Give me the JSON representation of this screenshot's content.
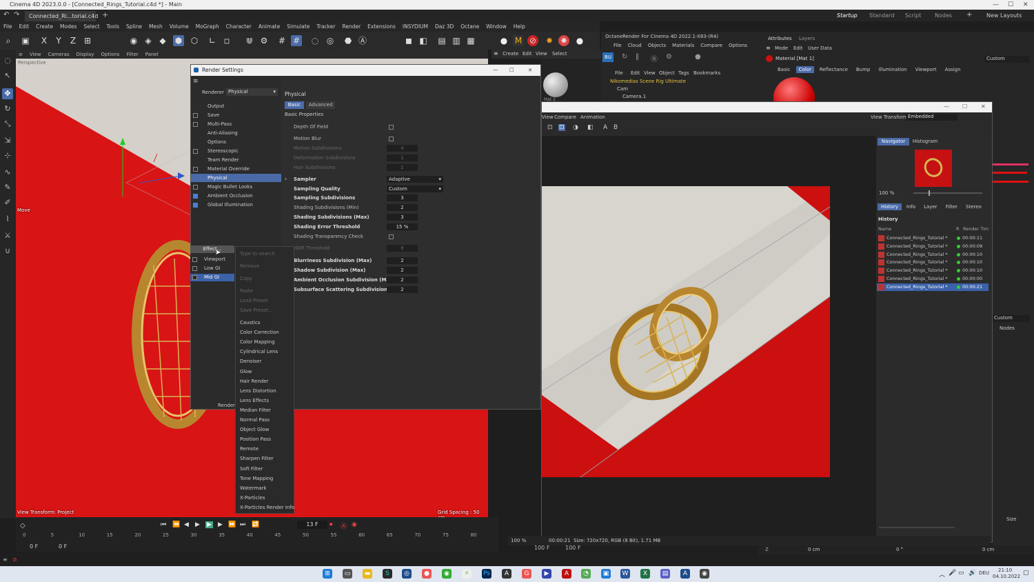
{
  "app": {
    "title": "Cinema 4D 2023.0.0 - [Connected_Rings_Tutorial.c4d *] - Main",
    "doc_tab": "Connected_Ri...torial.c4d *",
    "layouts": [
      "Startup",
      "Standard",
      "Script",
      "Nodes"
    ],
    "new_layouts": "New Layouts"
  },
  "menu": [
    "File",
    "Edit",
    "Create",
    "Modes",
    "Select",
    "Tools",
    "Spline",
    "Mesh",
    "Volume",
    "MoGraph",
    "Character",
    "Animate",
    "Simulate",
    "Tracker",
    "Render",
    "Extensions",
    "INSYDIUM",
    "Daz 3D",
    "Octane",
    "Window",
    "Help"
  ],
  "viewport": {
    "menu": [
      "View",
      "Cameras",
      "Display",
      "Options",
      "Filter",
      "Panel"
    ],
    "perspective": "Perspective",
    "move_label": "Move",
    "view_transform": "View Transform: Project",
    "grid_spacing": "Grid Spacing : 50 cm"
  },
  "timeline": {
    "frame_current": "13 F",
    "ticks": [
      "0",
      "5",
      "10",
      "15",
      "20",
      "25",
      "30",
      "35",
      "40",
      "45",
      "50",
      "55",
      "60",
      "65",
      "70",
      "75",
      "80"
    ],
    "start_a": "0 F",
    "start_b": "0 F",
    "end_a": "100 F",
    "end_b": "100 F"
  },
  "render_settings": {
    "title": "Render Settings",
    "renderer_label": "Renderer",
    "renderer_value": "Physical",
    "items": [
      {
        "label": "Output",
        "check": "none"
      },
      {
        "label": "Save",
        "check": "off"
      },
      {
        "label": "Multi-Pass",
        "check": "off"
      },
      {
        "label": "Anti-Aliasing",
        "check": "none"
      },
      {
        "label": "Options",
        "check": "none"
      },
      {
        "label": "Stereoscopic",
        "check": "off"
      },
      {
        "label": "Team Render",
        "check": "none"
      },
      {
        "label": "Material Override",
        "check": "off"
      },
      {
        "label": "Physical",
        "check": "none"
      },
      {
        "label": "Magic Bullet Looks",
        "check": "off"
      },
      {
        "label": "Ambient Occlusion",
        "check": "on"
      },
      {
        "label": "Global Illumination",
        "check": "on"
      }
    ],
    "effect_button": "Effect...",
    "effect_list": [
      "Viewport",
      "Low GI",
      "Mid GI"
    ],
    "render_button": "Render",
    "section_title": "Physical",
    "tabs": [
      "Basic",
      "Advanced"
    ],
    "group": "Basic Properties",
    "props": [
      {
        "label": "Depth Of Field",
        "type": "cb",
        "style": "normal"
      },
      {
        "label": "Motion Blur",
        "type": "cb",
        "style": "normal"
      },
      {
        "label": "Motion Subdivisions",
        "type": "val",
        "value": "4",
        "style": "dim"
      },
      {
        "label": "Deformation Subdivisions",
        "type": "val",
        "value": "1",
        "style": "dim"
      },
      {
        "label": "Hair Subdivisions",
        "type": "val",
        "value": "1",
        "style": "dim"
      },
      {
        "label": "Sampler",
        "type": "sel",
        "value": "Adaptive",
        "style": "bold"
      },
      {
        "label": "Sampling Quality",
        "type": "sel",
        "value": "Custom",
        "style": "bold"
      },
      {
        "label": "Sampling Subdivisions",
        "type": "val",
        "value": "3",
        "style": "bold"
      },
      {
        "label": "Shading Subdivisions (Min)",
        "type": "val",
        "value": "2",
        "style": "normal"
      },
      {
        "label": "Shading Subdivisions (Max)",
        "type": "val",
        "value": "3",
        "style": "bold"
      },
      {
        "label": "Shading Error Threshold",
        "type": "val",
        "value": "15 %",
        "style": "bold"
      },
      {
        "label": "Shading Transparency Check",
        "type": "cb",
        "style": "normal"
      },
      {
        "label": "HDR Threshold",
        "type": "val",
        "value": "8",
        "style": "dim"
      },
      {
        "label": "Blurriness Subdivision (Max)",
        "type": "val",
        "value": "2",
        "style": "bold"
      },
      {
        "label": "Shadow Subdivision (Max)",
        "type": "val",
        "value": "2",
        "style": "bold"
      },
      {
        "label": "Ambient Occlusion Subdivision (Max)",
        "type": "val",
        "value": "2",
        "style": "bold"
      },
      {
        "label": "Subsurface Scattering Subdivision (Max)",
        "type": "val",
        "value": "2",
        "style": "bold"
      }
    ]
  },
  "context_menu": {
    "search_placeholder": "Type to search",
    "disabled": [
      "Remove",
      "Copy",
      "Paste",
      "Load Preset",
      "Save Preset..."
    ],
    "items": [
      "Caustics",
      "Color Correction",
      "Color Mapping",
      "Cylindrical Lens",
      "Denoiser",
      "Glow",
      "Hair Render",
      "Lens Distortion",
      "Lens Effects",
      "Median Filter",
      "Normal Pass",
      "Object Glow",
      "Position Pass",
      "Remote",
      "Sharpen Filter",
      "Soft Filter",
      "Tone Mapping",
      "Watermark",
      "X-Particles",
      "X-Particles Render Info"
    ]
  },
  "octane": {
    "title": "OctaneRender For Cinema 4D 2022.1-X83-(R4)",
    "menu": [
      "File",
      "Cloud",
      "Objects",
      "Materials",
      "Compare",
      "Options"
    ],
    "mat_label": "Mat 2"
  },
  "objects": {
    "menu": [
      "File",
      "Edit",
      "View",
      "Object",
      "Tags",
      "Bookmarks"
    ],
    "menu2": [
      "Create",
      "Edit",
      "View",
      "Select"
    ],
    "items": [
      "Nikomedias Scene Rig Ultimate",
      "Cam",
      "Camera.1"
    ]
  },
  "attributes": {
    "tabs": [
      "Attributes",
      "Layers"
    ],
    "menu": [
      "Mode",
      "Edit",
      "User Data"
    ],
    "material": "Material [Mat 1]",
    "subtabs": [
      "Basic",
      "Color",
      "Reflectance",
      "Bump",
      "Illumination",
      "Viewport",
      "Assign"
    ],
    "custom": "Custom"
  },
  "picture_viewer": {
    "menu": [
      "View",
      "Compare",
      "Animation"
    ],
    "view_transform_label": "View Transform",
    "view_transform_value": "Embedded",
    "nav_tabs": [
      "Navigator",
      "Histogram"
    ],
    "zoom": "100 %",
    "hist_tabs": [
      "History",
      "Info",
      "Layer",
      "Filter",
      "Stereo"
    ],
    "history_title": "History",
    "col_name": "Name",
    "col_r": "R",
    "col_time": "Render Tim",
    "history": [
      {
        "name": "Connected_Rings_Tutorial *",
        "time": "00:00:11"
      },
      {
        "name": "Connected_Rings_Tutorial *",
        "time": "00:00:09"
      },
      {
        "name": "Connected_Rings_Tutorial *",
        "time": "00:00:10"
      },
      {
        "name": "Connected_Rings_Tutorial *",
        "time": "00:00:10"
      },
      {
        "name": "Connected_Rings_Tutorial *",
        "time": "00:00:10"
      },
      {
        "name": "Connected_Rings_Tutorial *",
        "time": "00:00:00"
      },
      {
        "name": "Connected_Rings_Tutorial *",
        "time": "00:00:21"
      }
    ],
    "status_zoom": "100 %",
    "status_time": "00:00:21",
    "status_size": "Size: 720x720, RGB (8 Bit), 1.71 MB"
  },
  "coords": {
    "z_label": "Z",
    "z_val": "0 cm",
    "angle": "0 °",
    "val2": "0 cm",
    "custom": "Custom",
    "nodes": "Nodes",
    "size": "Size"
  },
  "tray": {
    "lang": "DEU",
    "time": "21:10",
    "date": "04.10.2022"
  },
  "colors": {
    "accent": "#3b62a8",
    "red": "#d01010",
    "gold": "#c9a040"
  }
}
